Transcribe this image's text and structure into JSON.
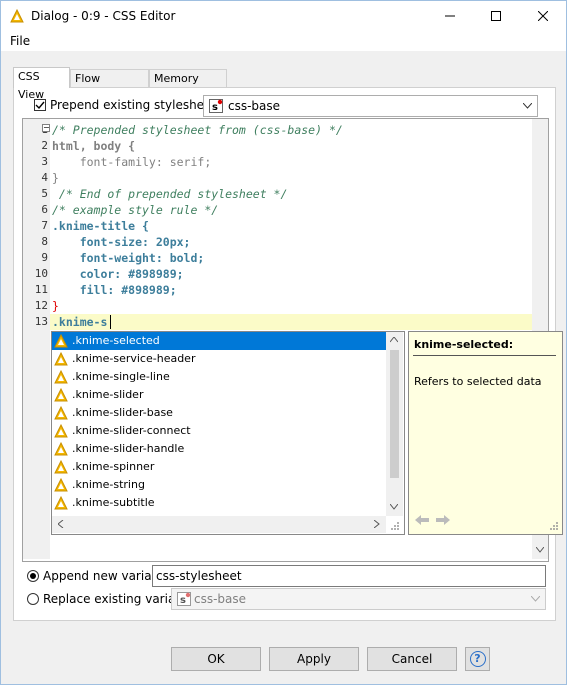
{
  "window": {
    "title": "Dialog - 0:9 - CSS Editor",
    "menu": [
      "File"
    ]
  },
  "tabs": [
    {
      "label": "CSS View",
      "active": true
    },
    {
      "label": "Flow Variables",
      "active": false
    },
    {
      "label": "Memory Policy",
      "active": false
    }
  ],
  "prepend": {
    "checkbox_label": "Prepend existing stylesheet:",
    "checked": true,
    "selected_stylesheet": "css-base"
  },
  "editor": {
    "line_numbers": [
      "1",
      "2",
      "3",
      "4",
      "5",
      "6",
      "7",
      "8",
      "9",
      "10",
      "11",
      "12",
      "13"
    ],
    "lines": [
      "/* Prepended stylesheet from (css-base) */",
      "html, body {",
      "    font-family: serif;",
      "}",
      " /* End of prepended stylesheet */",
      "/* example style rule */",
      ".knime-title {",
      "    font-size: 20px;",
      "    font-weight: bold;",
      "    color: #898989;",
      "    fill: #898989;",
      "}",
      ".knime-s"
    ],
    "fold_marker": "−"
  },
  "autocomplete": {
    "items": [
      ".knime-selected",
      ".knime-service-header",
      ".knime-single-line",
      ".knime-slider",
      ".knime-slider-base",
      ".knime-slider-connect",
      ".knime-slider-handle",
      ".knime-spinner",
      ".knime-string",
      ".knime-subtitle"
    ],
    "selected_index": 0
  },
  "doc_popup": {
    "title": "knime-selected:",
    "description": "Refers to selected data"
  },
  "variables": {
    "append_label": "Append new variable:",
    "append_value": "css-stylesheet",
    "replace_label": "Replace existing variable:",
    "replace_value": "css-base",
    "append_selected": true
  },
  "buttons": {
    "ok": "OK",
    "apply": "Apply",
    "cancel": "Cancel",
    "help": "?"
  },
  "colors": {
    "accent": "#0078d7",
    "comment": "#3f7f5f",
    "selector": "#3d7e9b",
    "value": "#7b1fa2",
    "brace": "#e00000",
    "doc_bg": "#ffffe1",
    "current_line": "#fbfbc8"
  }
}
